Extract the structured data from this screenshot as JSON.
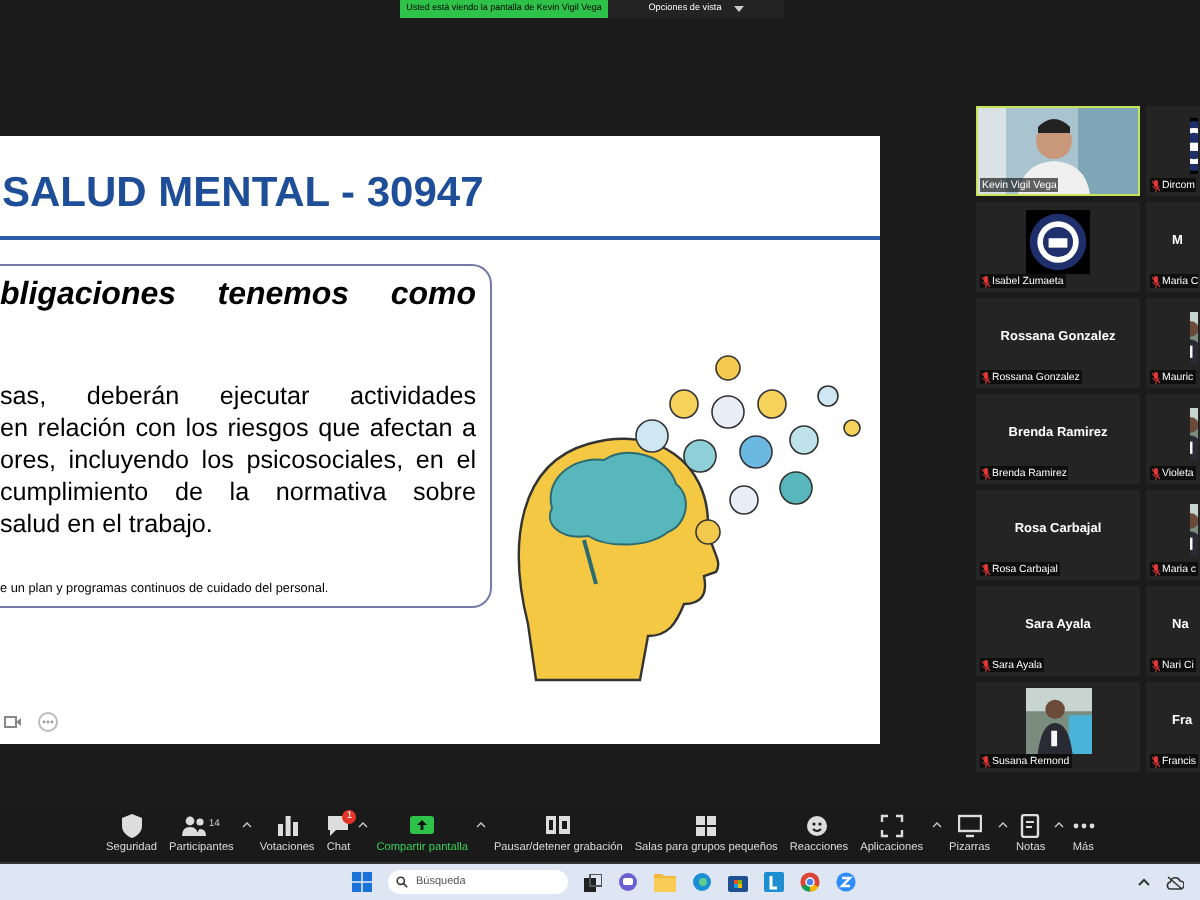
{
  "banner": {
    "text": "Usted está viendo la pantalla de Kevin Vigil Vega",
    "view_options": "Opciones de vista"
  },
  "slide": {
    "title": "SALUD MENTAL - 30947",
    "question": "bligaciones tenemos como",
    "paragraph": [
      "sas, deberán ejecutar actividades",
      "en relación con los riesgos que afectan a",
      "ores, incluyendo los psicosociales, en el",
      "cumplimiento de la normativa sobre",
      "salud en el trabajo."
    ],
    "note": "e un plan y programas continuos de cuidado del personal."
  },
  "participants": [
    {
      "label": "Kevin Vigil Vega",
      "kind": "video",
      "muted": false,
      "active_speaker": true
    },
    {
      "label": "Dircom",
      "kind": "logo",
      "muted": true,
      "active_speaker": false
    },
    {
      "label": "Isabel Zumaeta",
      "kind": "logo",
      "muted": true,
      "active_speaker": false
    },
    {
      "label": "Maria C",
      "kind": "name",
      "display_name": "M",
      "muted": true,
      "active_speaker": false
    },
    {
      "label": "Rossana Gonzalez",
      "kind": "name",
      "display_name": "Rossana Gonzalez",
      "muted": true,
      "active_speaker": false
    },
    {
      "label": "Mauric",
      "muted": true,
      "active_speaker": false
    },
    {
      "label": "Brenda Ramirez",
      "kind": "name",
      "display_name": "Brenda Ramirez",
      "muted": true,
      "active_speaker": false
    },
    {
      "label": "Violeta",
      "muted": true,
      "active_speaker": false
    },
    {
      "label": "Rosa Carbajal",
      "kind": "name",
      "display_name": "Rosa Carbajal",
      "muted": true,
      "active_speaker": false
    },
    {
      "label": "Maria c",
      "muted": true,
      "active_speaker": false
    },
    {
      "label": "Sara Ayala",
      "kind": "name",
      "display_name": "Sara Ayala",
      "muted": true,
      "active_speaker": false
    },
    {
      "label": "Nari Ci",
      "kind": "name",
      "display_name": "Na",
      "muted": true,
      "active_speaker": false
    },
    {
      "label": "Susana Remond",
      "muted": true,
      "active_speaker": false
    },
    {
      "label": "Francis",
      "kind": "name",
      "display_name": "Fra",
      "muted": true,
      "active_speaker": false
    }
  ],
  "toolbar": [
    {
      "label": "Seguridad",
      "caret": false,
      "selected": false
    },
    {
      "label": "Participantes",
      "count": "14",
      "caret": true,
      "selected": false
    },
    {
      "label": "Votaciones",
      "caret": false,
      "selected": false
    },
    {
      "label": "Chat",
      "badge": "1",
      "caret": true,
      "selected": false
    },
    {
      "label": "Compartir pantalla",
      "caret": true,
      "selected": true
    },
    {
      "label": "Pausar/detener grabación",
      "caret": false,
      "selected": false
    },
    {
      "label": "Salas para grupos pequeños",
      "caret": false,
      "selected": false
    },
    {
      "label": "Reacciones",
      "caret": false,
      "selected": false
    },
    {
      "label": "Aplicaciones",
      "caret": true,
      "selected": false
    },
    {
      "label": "Pizarras",
      "caret": true,
      "selected": false
    },
    {
      "label": "Notas",
      "caret": true,
      "selected": false
    },
    {
      "label": "Más",
      "caret": false,
      "selected": false
    }
  ],
  "taskbar": {
    "search_placeholder": "Búsqueda"
  }
}
